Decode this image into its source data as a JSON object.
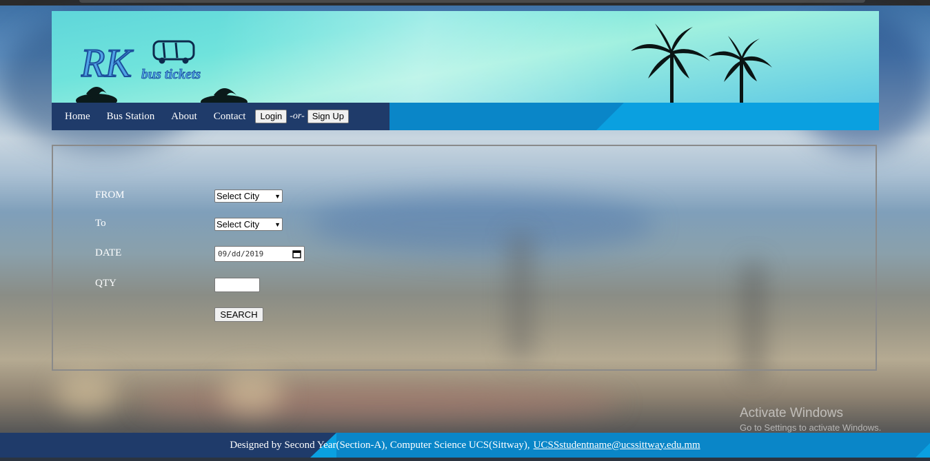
{
  "logo": {
    "big": "RK",
    "small": "bus tickets"
  },
  "nav": {
    "links": [
      "Home",
      "Bus Station",
      "About",
      "Contact"
    ],
    "login_label": "Login",
    "or_text": "-or-",
    "signup_label": "Sign Up"
  },
  "form": {
    "from_label": "FROM",
    "to_label": "To",
    "date_label": "DATE",
    "qty_label": "QTY",
    "from_value": "Select City",
    "to_value": "Select City",
    "date_value": "09/dd/2019",
    "search_label": "SEARCH"
  },
  "watermark": {
    "line1": "Activate Windows",
    "line2": "Go to Settings to activate Windows."
  },
  "footer": {
    "text": "Designed by Second Year(Section-A), Computer Science UCS(Sittway),",
    "email": "UCSSstudentname@ucssittway.edu.mm"
  }
}
